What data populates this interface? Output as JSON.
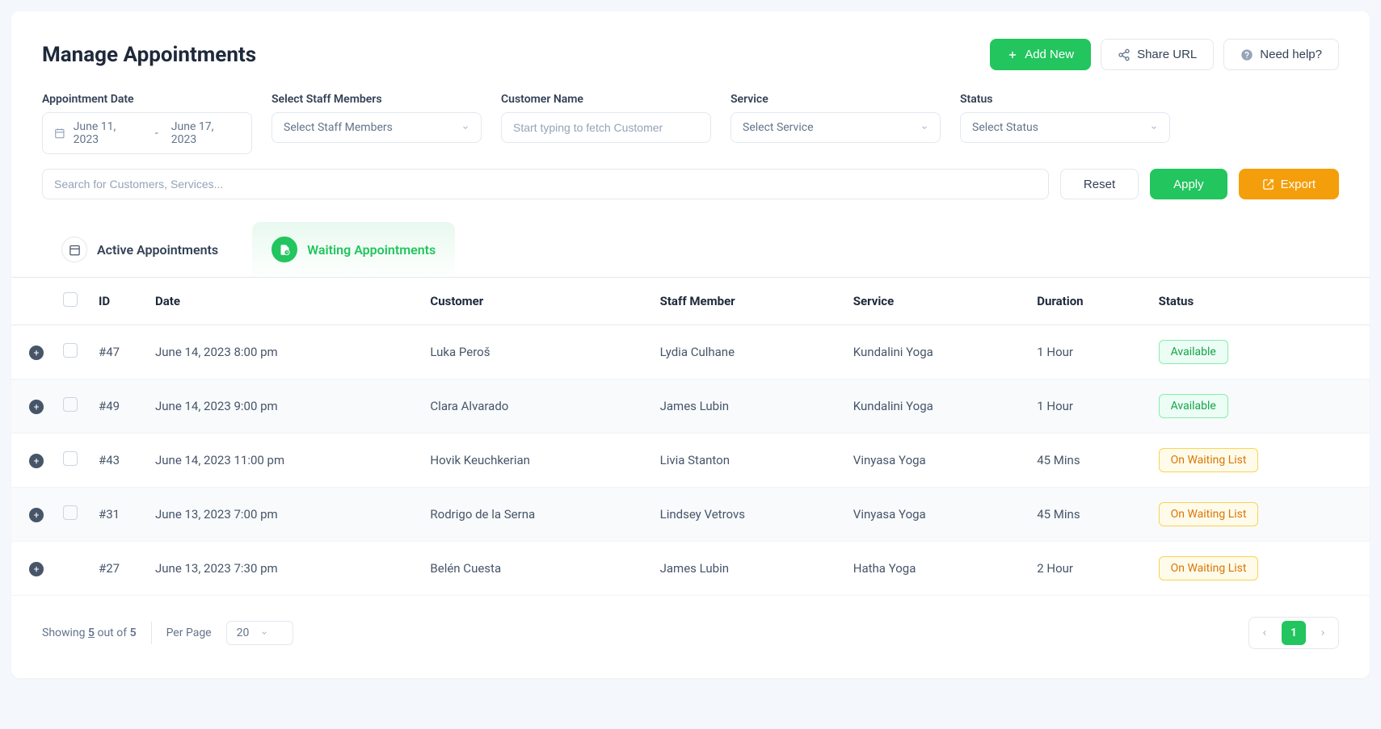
{
  "title": "Manage Appointments",
  "headerButtons": {
    "addNew": "Add New",
    "shareUrl": "Share URL",
    "needHelp": "Need help?"
  },
  "filters": {
    "dateLabel": "Appointment Date",
    "dateStart": "June 11, 2023",
    "dateSep": "-",
    "dateEnd": "June 17, 2023",
    "staffLabel": "Select Staff Members",
    "staffPlaceholder": "Select Staff Members",
    "customerLabel": "Customer Name",
    "customerPlaceholder": "Start typing to fetch Customer",
    "serviceLabel": "Service",
    "servicePlaceholder": "Select Service",
    "statusLabel": "Status",
    "statusPlaceholder": "Select Status",
    "searchPlaceholder": "Search for Customers, Services...",
    "reset": "Reset",
    "apply": "Apply",
    "export": "Export"
  },
  "tabs": {
    "active": "Active Appointments",
    "waiting": "Waiting Appointments"
  },
  "columns": {
    "id": "ID",
    "date": "Date",
    "customer": "Customer",
    "staff": "Staff Member",
    "service": "Service",
    "duration": "Duration",
    "status": "Status"
  },
  "rows": [
    {
      "id": "#47",
      "date": "June 14, 2023 8:00 pm",
      "customer": "Luka Peroš",
      "staff": "Lydia Culhane",
      "service": "Kundalini Yoga",
      "duration": "1 Hour",
      "status": "Available",
      "statusType": "available",
      "hasCheckbox": true
    },
    {
      "id": "#49",
      "date": "June 14, 2023 9:00 pm",
      "customer": "Clara Alvarado",
      "staff": "James Lubin",
      "service": "Kundalini Yoga",
      "duration": "1 Hour",
      "status": "Available",
      "statusType": "available",
      "hasCheckbox": true
    },
    {
      "id": "#43",
      "date": "June 14, 2023 11:00 pm",
      "customer": "Hovik Keuchkerian",
      "staff": "Livia Stanton",
      "service": "Vinyasa Yoga",
      "duration": "45 Mins",
      "status": "On Waiting List",
      "statusType": "waiting",
      "hasCheckbox": true
    },
    {
      "id": "#31",
      "date": "June 13, 2023 7:00 pm",
      "customer": "Rodrigo de la Serna",
      "staff": "Lindsey Vetrovs",
      "service": "Vinyasa Yoga",
      "duration": "45 Mins",
      "status": "On Waiting List",
      "statusType": "waiting",
      "hasCheckbox": true
    },
    {
      "id": "#27",
      "date": "June 13, 2023 7:30 pm",
      "customer": "Belén Cuesta",
      "staff": "James Lubin",
      "service": "Hatha Yoga",
      "duration": "2 Hour",
      "status": "On Waiting List",
      "statusType": "waiting",
      "hasCheckbox": false
    }
  ],
  "footer": {
    "showingPrefix": "Showing ",
    "showingCount": "5",
    "showingMid": " out of ",
    "showingTotal": "5",
    "perPage": "Per Page",
    "perPageValue": "20",
    "page": "1"
  }
}
